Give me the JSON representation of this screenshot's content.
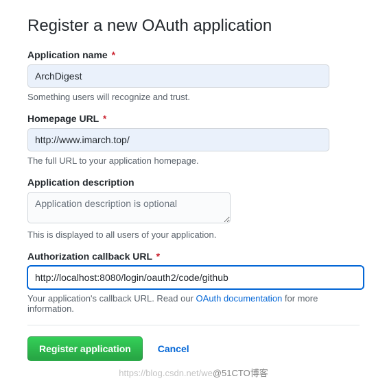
{
  "page": {
    "title": "Register a new OAuth application"
  },
  "fields": {
    "appName": {
      "label": "Application name",
      "required": "*",
      "value": "ArchDigest",
      "help": "Something users will recognize and trust."
    },
    "homepage": {
      "label": "Homepage URL",
      "required": "*",
      "value": "http://www.imarch.top/",
      "help": "The full URL to your application homepage."
    },
    "description": {
      "label": "Application description",
      "placeholder": "Application description is optional",
      "value": "",
      "help": "This is displayed to all users of your application."
    },
    "callback": {
      "label": "Authorization callback URL",
      "required": "*",
      "value": "http://localhost:8080/login/oauth2/code/github",
      "helpPrefix": "Your application's callback URL. Read our ",
      "helpLink": "OAuth documentation",
      "helpSuffix": " for more information."
    }
  },
  "actions": {
    "submit": "Register application",
    "cancel": "Cancel"
  },
  "watermark": {
    "faint": "https://blog.csdn.net/we",
    "handle": "@51CTO博客"
  }
}
